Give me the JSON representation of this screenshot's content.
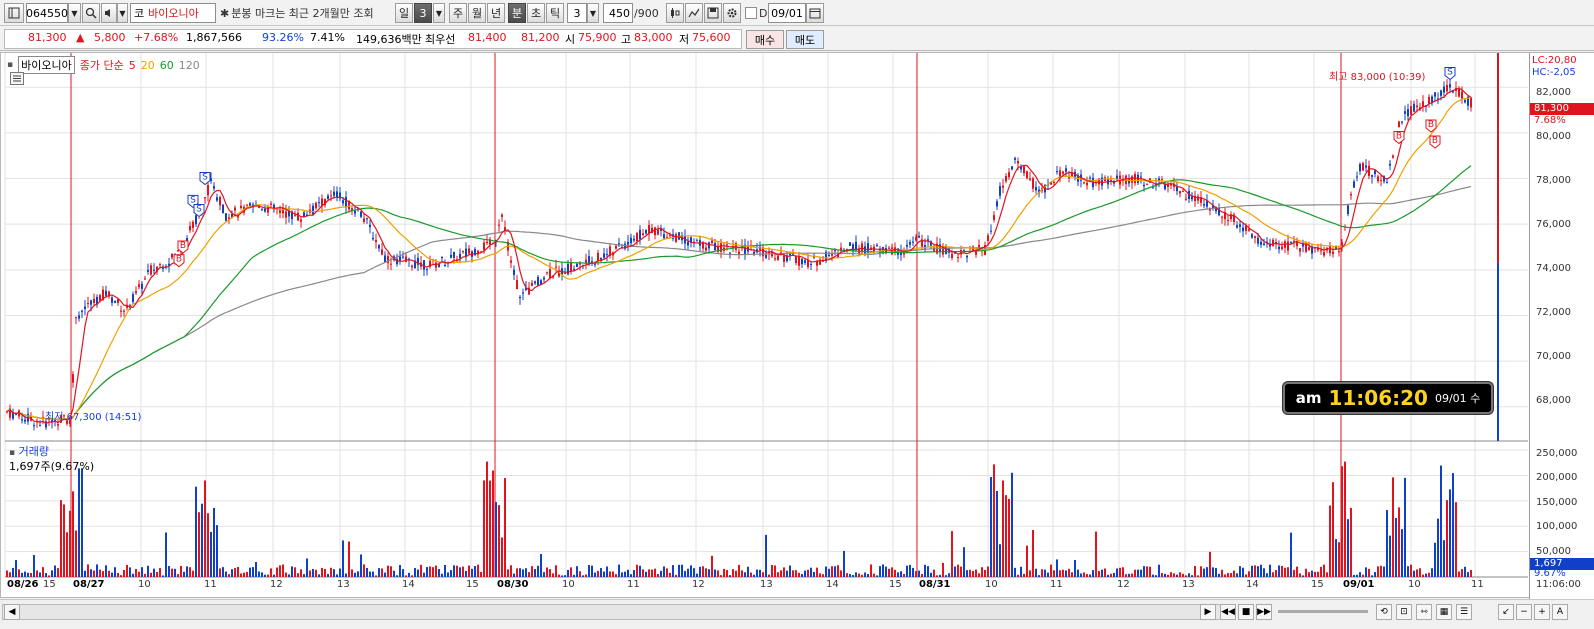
{
  "toolbar": {
    "code": "064550",
    "market": "코",
    "stock_name": "바이오니아",
    "note": "분봉 마크는 최근 2개월만 조회",
    "period_day": "일",
    "period_interval": "3",
    "period_week": "주",
    "period_month": "월",
    "period_year": "년",
    "period_minute": "분",
    "period_second": "초",
    "period_tick": "틱",
    "interval_value": "3",
    "count_value": "450",
    "count_max": "/900",
    "checkbox_label": "D",
    "date_value": "09/01"
  },
  "quote": {
    "price": "81,300",
    "arrow": "▲",
    "change": "5,800",
    "change_pct": "+7.68%",
    "volume": "1,867,566",
    "vol_ratio": "93.26%",
    "turnover": "7.41%",
    "amount": "149,636백만",
    "best_label": "최우선",
    "ask": "81,400",
    "bid": "81,200",
    "open_label": "시",
    "open": "75,900",
    "high_label": "고",
    "high": "83,000",
    "low_label": "저",
    "low": "75,600",
    "buy_label": "매수",
    "sell_label": "매도"
  },
  "chart": {
    "name": "바이오니아",
    "price_legend": "종가 단순",
    "ma": [
      "5",
      "20",
      "60",
      "120"
    ],
    "ma_colors": [
      "#e0141e",
      "#f0a000",
      "#1a9a2a",
      "#888888"
    ],
    "y_labels": [
      "82,000",
      "80,000",
      "78,000",
      "76,000",
      "74,000",
      "72,000",
      "70,000",
      "68,000"
    ],
    "lc": "LC:20,80",
    "hc": "HC:-2,05",
    "current_price": "81,300",
    "current_pct": "7.68%",
    "high_annotation": "최고 83,000 (10:39)",
    "low_annotation": "최저 67,300 (14:51)",
    "volume_title": "거래량",
    "volume_value": "1,697주(9.67%)",
    "vol_y_labels": [
      "250,000",
      "200,000",
      "150,000",
      "100,000",
      "50,000"
    ],
    "vol_current": "1,697",
    "vol_pct": "9.67%",
    "x_labels": [
      "08/26",
      "15",
      "08/27",
      "10",
      "11",
      "12",
      "13",
      "14",
      "15",
      "08/30",
      "10",
      "11",
      "12",
      "13",
      "14",
      "15",
      "08/31",
      "10",
      "11",
      "12",
      "13",
      "14",
      "15",
      "09/01",
      "10",
      "11"
    ],
    "time_label": "11:06:00",
    "clock": {
      "ampm": "am",
      "time": "11:06:20",
      "date": "09/01 수"
    }
  },
  "chart_data": {
    "type": "line",
    "title": "",
    "xlabel": "",
    "ylabel": "",
    "ylim": [
      66500,
      83500
    ],
    "x": [
      "08/26",
      "08/27",
      "08/30",
      "08/31",
      "09/01"
    ],
    "series": [
      {
        "name": "종가",
        "values": [
          67300,
          73800,
          74500,
          77700,
          81300
        ]
      }
    ],
    "volume_ylim": [
      0,
      260000
    ],
    "grid": true,
    "legend_position": "top-left"
  }
}
